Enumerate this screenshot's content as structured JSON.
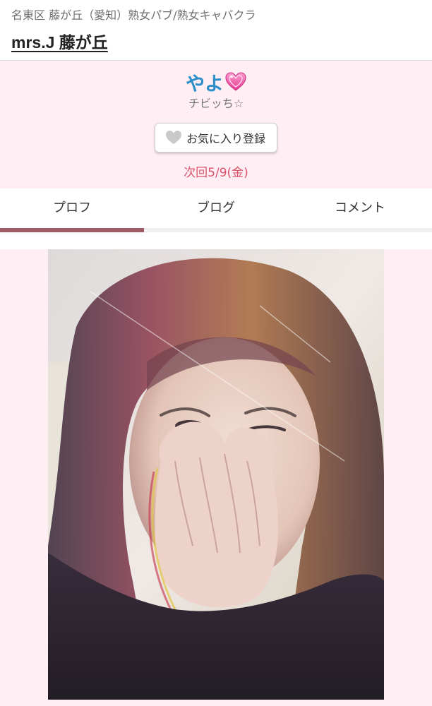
{
  "header": {
    "breadcrumb": "名東区 藤が丘（愛知）熟女パブ/熟女キャバクラ",
    "shop_name": "mrs.J 藤が丘"
  },
  "profile": {
    "name": "やよ",
    "name_icon": "pink-heart-icon",
    "catch_phrase": "チビッち☆",
    "favorite_button_label": "お気に入り登録",
    "favorite_icon": "gray-heart-icon",
    "next_schedule": "次回5/9(金)"
  },
  "tabs": {
    "items": [
      {
        "label": "プロフ",
        "active": true
      },
      {
        "label": "ブログ",
        "active": false
      },
      {
        "label": "コメント",
        "active": false
      }
    ]
  },
  "colors": {
    "name": "#2c8fc9",
    "schedule": "#d9536b",
    "profile_bg": "#ffeef3",
    "active_tab_indicator": "#a15b64"
  }
}
